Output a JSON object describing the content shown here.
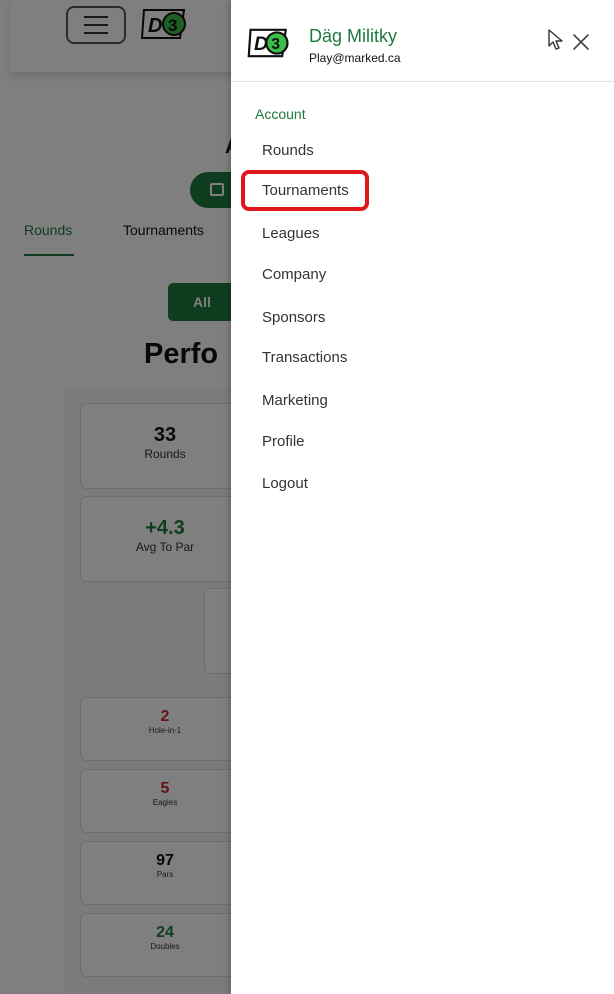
{
  "background": {
    "tabs": [
      "Rounds",
      "Tournaments"
    ],
    "page_heading_fragment": "A",
    "filter_label": "All",
    "section_heading": "Perfo",
    "stats": [
      {
        "value": "33",
        "label": "Rounds"
      },
      {
        "value": "+4.3",
        "label": "Avg To Par"
      }
    ],
    "small_stats": [
      {
        "value": "2",
        "label": "Hole-in-1"
      },
      {
        "value": "5",
        "label": "Eagles"
      },
      {
        "value": "97",
        "label": "Pars"
      },
      {
        "value": "24",
        "label": "Doubles"
      }
    ]
  },
  "drawer": {
    "user_name": "Däg Militky",
    "user_email": "Play@marked.ca",
    "section_label": "Account",
    "menu_items": [
      "Rounds",
      "Tournaments",
      "Leagues",
      "Company",
      "Sponsors",
      "Transactions",
      "Marketing",
      "Profile",
      "Logout"
    ],
    "highlighted_item": "Tournaments"
  },
  "colors": {
    "brand_green": "#1e7a3e",
    "highlight_red": "#e0161b",
    "negative_red": "#c62828"
  },
  "icons": [
    "hamburger-icon",
    "d3-logo-icon",
    "calendar-icon",
    "cursor-icon",
    "close-icon"
  ]
}
